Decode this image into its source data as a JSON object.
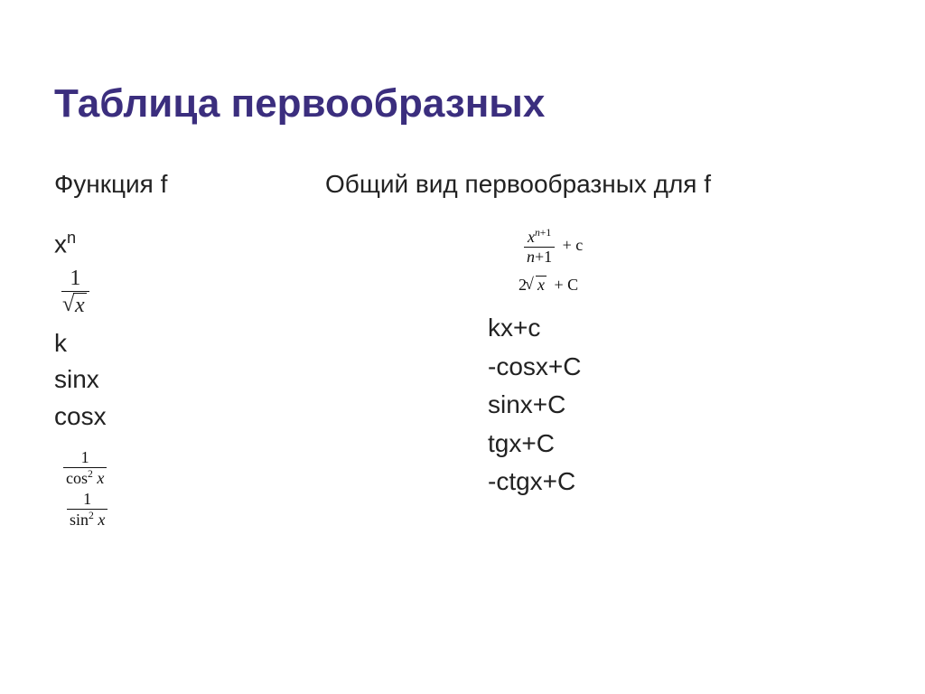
{
  "title": "Таблица первообразных",
  "headers": {
    "left": "Функция f",
    "right": "Общий вид первообразных для f"
  },
  "left": {
    "xn_base": "x",
    "xn_exp": "n",
    "frac1_num": "1",
    "frac1_den_x": "x",
    "k": "k",
    "sinx": "sinx",
    "cosx": "cosx",
    "frac_cos2_num": "1",
    "frac_cos2_den_cos": "cos",
    "frac_cos2_den_exp": "2",
    "frac_cos2_den_x": "x",
    "frac_sin2_num": "1",
    "frac_sin2_den_sin": "sin",
    "frac_sin2_den_exp": "2",
    "frac_sin2_den_x": "x"
  },
  "right": {
    "power_num_base": "x",
    "power_num_exp_a": "n",
    "power_num_exp_plus": "+",
    "power_num_exp_b": "1",
    "power_den_a": "n",
    "power_den_plus": "+",
    "power_den_b": "1",
    "power_tail": "+ c",
    "sqrt_coeff": "2",
    "sqrt_x": "x",
    "sqrt_tail": "+ C",
    "kxc": "kx+c",
    "mcosxc": "-cosx+C",
    "sinxc": "sinx+C",
    "tgxc": "tgx+C",
    "mctgxc": "-ctgx+C"
  }
}
